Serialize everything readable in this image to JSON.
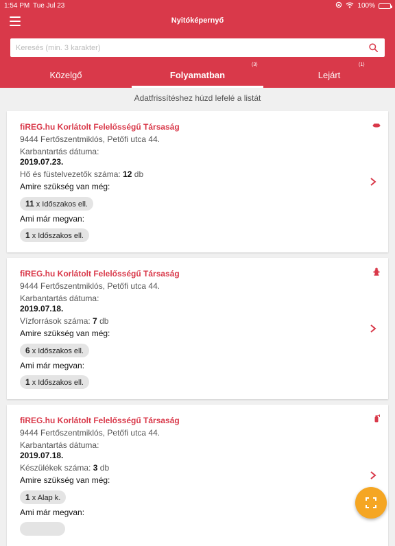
{
  "status_bar": {
    "time": "1:54 PM",
    "date": "Tue Jul 23",
    "battery": "100%"
  },
  "header": {
    "title": "Nyitóképernyő"
  },
  "search": {
    "placeholder": "Keresés (min. 3 karakter)"
  },
  "tabs": [
    {
      "label": "Közelgő",
      "count": ""
    },
    {
      "label": "Folyamatban",
      "count": "(3)"
    },
    {
      "label": "Lejárt",
      "count": "(1)"
    }
  ],
  "hint": "Adatfrissítéshez húzd lefelé a listát",
  "cards": [
    {
      "company": "fiREG.hu Korlátolt Felelősségű Társaság",
      "address": "9444 Fertőszentmiklós, Petőfi utca 44.",
      "maintenance_label": "Karbantartás dátuma:",
      "maintenance_date": "2019.07.23.",
      "count_label": "Hő és füstelvezetők száma:",
      "count_value": "12",
      "count_unit": "db",
      "needed_label": "Amire szükség van még:",
      "needed_qty": "11",
      "needed_text": "x Időszakos ell.",
      "have_label": "Ami már megvan:",
      "have_qty": "1",
      "have_text": "x Időszakos ell.",
      "icon": "smoke-vent-icon"
    },
    {
      "company": "fiREG.hu Korlátolt Felelősségű Társaság",
      "address": "9444 Fertőszentmiklós, Petőfi utca 44.",
      "maintenance_label": "Karbantartás dátuma:",
      "maintenance_date": "2019.07.18.",
      "count_label": "Vízforrások száma:",
      "count_value": "7",
      "count_unit": "db",
      "needed_label": "Amire szükség van még:",
      "needed_qty": "6",
      "needed_text": "x Időszakos ell.",
      "have_label": "Ami már megvan:",
      "have_qty": "1",
      "have_text": "x Időszakos ell.",
      "icon": "hydrant-icon"
    },
    {
      "company": "fiREG.hu Korlátolt Felelősségű Társaság",
      "address": "9444 Fertőszentmiklós, Petőfi utca 44.",
      "maintenance_label": "Karbantartás dátuma:",
      "maintenance_date": "2019.07.18.",
      "count_label": "Készülékek száma:",
      "count_value": "3",
      "count_unit": "db",
      "needed_label": "Amire szükség van még:",
      "needed_qty": "1",
      "needed_text": "x Alap k.",
      "have_label": "Ami már megvan:",
      "have_qty": "",
      "have_text": "",
      "icon": "fire-extinguisher-icon"
    }
  ],
  "colors": {
    "brand": "#d9394a",
    "fab": "#f5a623"
  }
}
